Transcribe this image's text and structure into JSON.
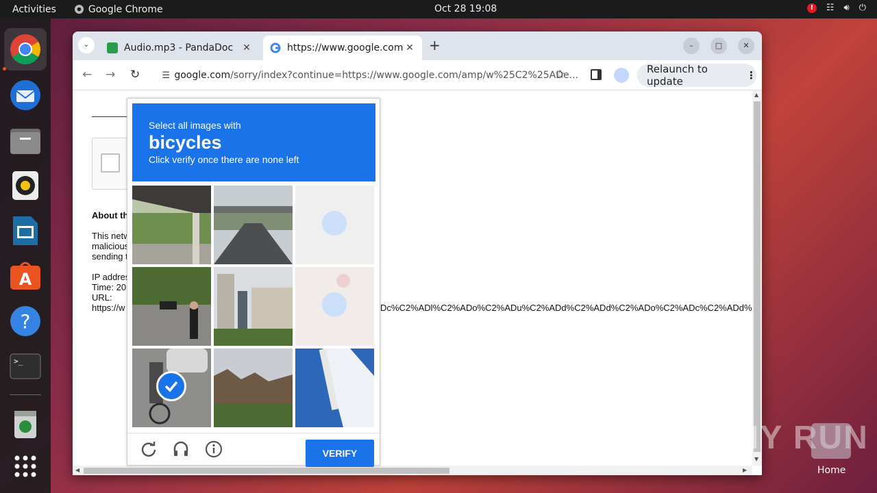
{
  "topbar": {
    "activities": "Activities",
    "app_name": "Google Chrome",
    "clock": "Oct 28  19:08",
    "alert": "!"
  },
  "dock": {
    "items": [
      "Google Chrome",
      "Thunderbird Mail",
      "Files",
      "Rhythmbox",
      "LibreOffice Impress",
      "Ubuntu Software",
      "Help",
      "Terminal",
      "Trash",
      "Show Applications"
    ]
  },
  "browser": {
    "tabs": [
      {
        "title": "Audio.mp3 - PandaDoc",
        "favicon_color": "#2a9d4c"
      },
      {
        "title": "https://www.google.com",
        "favicon_color": "#4285f4"
      }
    ],
    "url_host": "google.com",
    "url_path": "/sorry/index?continue=https://www.google.com/amp/w%25C2%25ADe...",
    "relaunch_label": "Relaunch to update"
  },
  "page": {
    "about": "About th",
    "para1": "This netw",
    "para2": "malicious",
    "para3": "sending t",
    "ip_label": "IP addres",
    "time_label": "Time: 20",
    "url_label": "URL:",
    "url_start": "https://w",
    "url_overflow": "Dc%C2%ADl%C2%ADo%C2%ADu%C2%ADd%C2%ADd%C2%ADo%C2%ADc%C2%ADd%"
  },
  "captcha": {
    "instruction_1": "Select all images with",
    "target": "bicycles",
    "instruction_2": "Click verify once there are none left",
    "verify_label": "VERIFY",
    "tiles": [
      {
        "scene": "overpass",
        "state": "normal"
      },
      {
        "scene": "road",
        "state": "normal"
      },
      {
        "scene": "blank",
        "state": "faded-selected"
      },
      {
        "scene": "street-people",
        "state": "normal"
      },
      {
        "scene": "buildings",
        "state": "normal"
      },
      {
        "scene": "cyclist",
        "state": "faded-selected"
      },
      {
        "scene": "bicycle-street",
        "state": "selected"
      },
      {
        "scene": "trees",
        "state": "normal"
      },
      {
        "scene": "boat",
        "state": "normal"
      }
    ]
  },
  "desktop": {
    "watermark": "ANY RUN",
    "home_label": "Home"
  }
}
